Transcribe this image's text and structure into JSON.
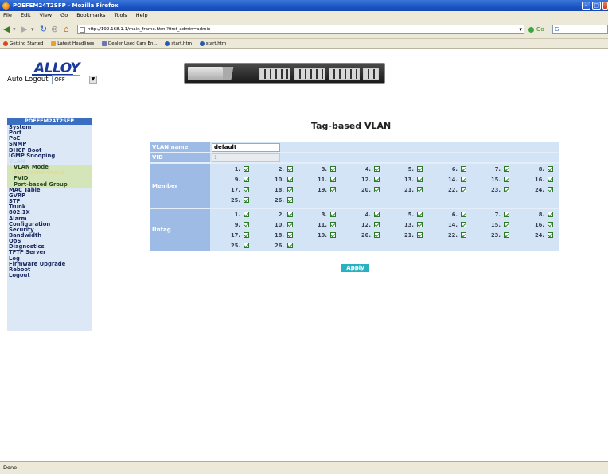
{
  "window": {
    "title": "POEFEM24T2SFP - Mozilla Firefox"
  },
  "menu": [
    "File",
    "Edit",
    "View",
    "Go",
    "Bookmarks",
    "Tools",
    "Help"
  ],
  "nav": {
    "url": "http://192.168.1.1/main_frame.html?first_admin=admin",
    "go_label": "Go",
    "search_text": "G"
  },
  "bookmarks": [
    "Getting Started",
    "Latest Headlines",
    "Dealer Used Cars En...",
    "start.htm",
    "start.htm"
  ],
  "header": {
    "logo": "ALLOY",
    "auto_logout_label": "Auto Logout",
    "auto_logout_value": "OFF"
  },
  "sidebar": {
    "title": "POEFEM24T2SFP",
    "items": [
      {
        "label": "System",
        "type": "main"
      },
      {
        "label": "Port",
        "type": "main"
      },
      {
        "label": "PoE",
        "type": "main"
      },
      {
        "label": "SNMP",
        "type": "main"
      },
      {
        "label": "DHCP Boot",
        "type": "main"
      },
      {
        "label": "IGMP Snooping",
        "type": "main"
      },
      {
        "label": "VLAN",
        "type": "section"
      },
      {
        "label": "VLAN Mode",
        "type": "sub"
      },
      {
        "label": "Tag-based Group",
        "type": "sub-active"
      },
      {
        "label": "PVID",
        "type": "sub"
      },
      {
        "label": "Port-based Group",
        "type": "sub"
      },
      {
        "label": "MAC Table",
        "type": "main"
      },
      {
        "label": "GVRP",
        "type": "main"
      },
      {
        "label": "STP",
        "type": "main"
      },
      {
        "label": "Trunk",
        "type": "main"
      },
      {
        "label": "802.1X",
        "type": "main"
      },
      {
        "label": "Alarm",
        "type": "main"
      },
      {
        "label": "Configuration",
        "type": "main"
      },
      {
        "label": "Security",
        "type": "main"
      },
      {
        "label": "Bandwidth",
        "type": "main"
      },
      {
        "label": "QoS",
        "type": "main"
      },
      {
        "label": "Diagnostics",
        "type": "main"
      },
      {
        "label": "TFTP Server",
        "type": "main"
      },
      {
        "label": "Log",
        "type": "main"
      },
      {
        "label": "Firmware Upgrade",
        "type": "main"
      },
      {
        "label": "Reboot",
        "type": "main"
      },
      {
        "label": "Logout",
        "type": "main"
      }
    ]
  },
  "page": {
    "title": "Tag-based VLAN"
  },
  "form": {
    "vlan_name_label": "VLAN name",
    "vlan_name_value": "default",
    "vid_label": "VID",
    "vid_value": "1",
    "member_label": "Member",
    "untag_label": "Untag",
    "ports": [
      "1.",
      "2.",
      "3.",
      "4.",
      "5.",
      "6.",
      "7.",
      "8.",
      "9.",
      "10.",
      "11.",
      "12.",
      "13.",
      "14.",
      "15.",
      "16.",
      "17.",
      "18.",
      "19.",
      "20.",
      "21.",
      "22.",
      "23.",
      "24.",
      "25.",
      "26."
    ],
    "member_checked": [
      true,
      true,
      true,
      true,
      true,
      true,
      true,
      true,
      true,
      true,
      true,
      true,
      true,
      true,
      true,
      true,
      true,
      true,
      true,
      true,
      true,
      true,
      true,
      true,
      true,
      true
    ],
    "untag_checked": [
      true,
      true,
      true,
      true,
      true,
      true,
      true,
      true,
      true,
      true,
      true,
      true,
      true,
      true,
      true,
      true,
      true,
      true,
      true,
      true,
      true,
      true,
      true,
      true,
      true,
      true
    ],
    "apply_label": "Apply"
  },
  "status": {
    "text": "Done"
  },
  "colors": {
    "sidebar_head": "#3a6ec0",
    "label_bg": "#9dbbe4",
    "row_bg": "#d3e4f7",
    "apply_bg": "#2ab0c0"
  }
}
